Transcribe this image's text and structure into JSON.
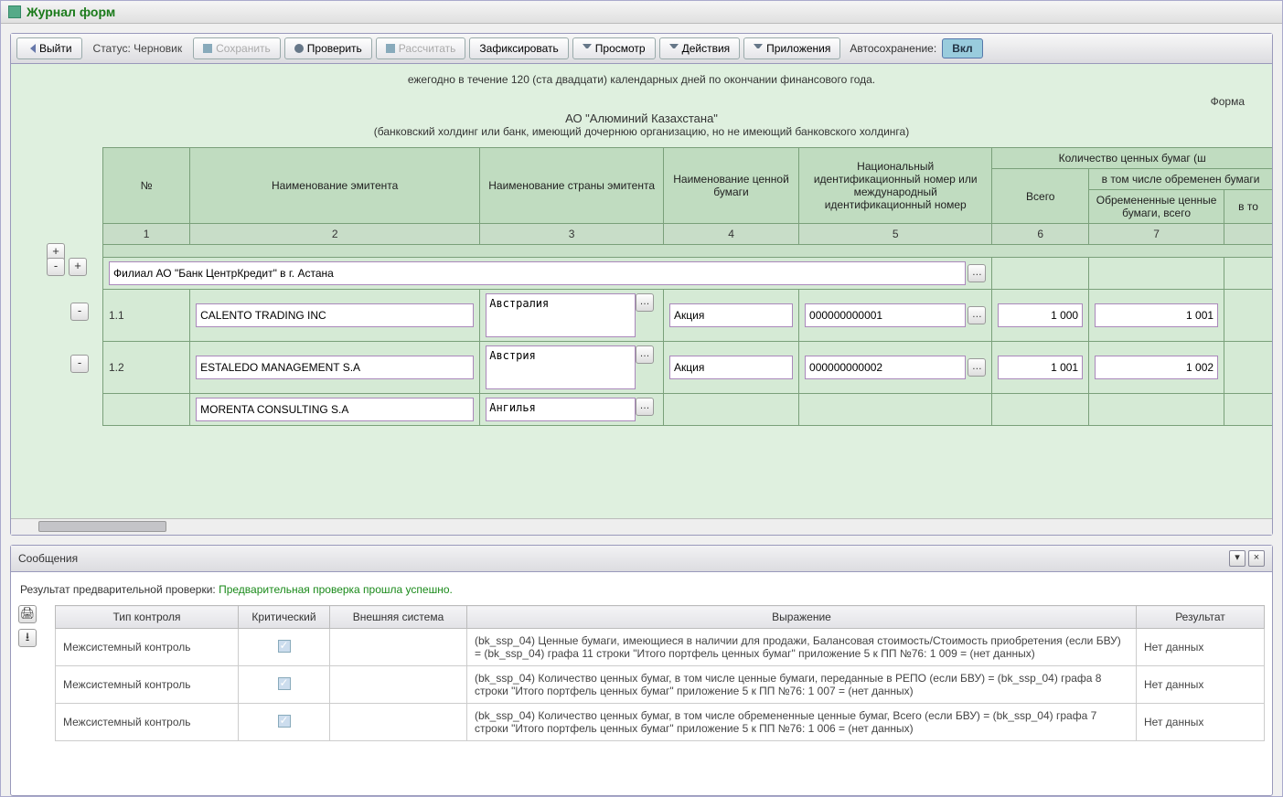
{
  "title": "Журнал форм",
  "toolbar": {
    "exit": "Выйти",
    "status_label": "Статус:",
    "status_value": "Черновик",
    "save": "Сохранить",
    "check": "Проверить",
    "calc": "Рассчитать",
    "fix": "Зафиксировать",
    "preview": "Просмотр",
    "actions": "Действия",
    "attachments": "Приложения",
    "autosave_label": "Автосохранение:",
    "autosave_on": "Вкл"
  },
  "form": {
    "desc": "ежегодно в течение 120 (ста двадцати) календарных дней по окончании финансового года.",
    "forma": "Форма",
    "org": "АО \"Алюминий Казахстана\"",
    "org_sub": "(банковский холдинг или банк, имеющий дочернюю организацию, но не имеющий банковского холдинга)"
  },
  "grid": {
    "headers": {
      "no": "№",
      "issuer": "Наименование эмитента",
      "country": "Наименование страны эмитента",
      "security": "Наименование ценной бумаги",
      "natid": "Национальный идентификационный номер или международный идентификационный номер",
      "qty_group": "Количество ценных бумаг (ш",
      "incl_group": "в том числе обременен бумаги",
      "total": "Всего",
      "encumbered": "Обремененные ценные бумаги, всего",
      "incl2": "в то"
    },
    "colnums": [
      "1",
      "2",
      "3",
      "4",
      "5",
      "6",
      "7"
    ],
    "branch": "Филиал АО \"Банк ЦентрКредит\" в г. Астана",
    "rows": [
      {
        "no": "1.1",
        "issuer": "CALENTO TRADING INC",
        "country": "Австралия",
        "security": "Акция",
        "natid": "000000000001",
        "total": "1 000",
        "enc": "1 001"
      },
      {
        "no": "1.2",
        "issuer": "ESTALEDO MANAGEMENT S.A",
        "country": "Австрия",
        "security": "Акция",
        "natid": "000000000002",
        "total": "1 001",
        "enc": "1 002"
      },
      {
        "no": "",
        "issuer": "MORENTA CONSULTING S.A",
        "country": "Ангилья",
        "security": "",
        "natid": "",
        "total": "",
        "enc": ""
      }
    ]
  },
  "messages": {
    "title": "Сообщения",
    "result_prefix": "Результат предварительной проверки: ",
    "result_ok": "Предварительная проверка прошла успешно.",
    "cols": {
      "type": "Тип контроля",
      "critical": "Критический",
      "ext": "Внешняя система",
      "expr": "Выражение",
      "res": "Результат"
    },
    "rows": [
      {
        "type": "Межсистемный контроль",
        "expr": "(bk_ssp_04) Ценные бумаги, имеющиеся в наличии для продажи, Балансовая стоимость/Стоимость приобретения (если БВУ) = (bk_ssp_04) графа 11 строки \"Итого портфель ценных бумаг\" приложение 5 к ПП №76: 1 009 = (нет данных)",
        "res": "Нет данных"
      },
      {
        "type": "Межсистемный контроль",
        "expr": "(bk_ssp_04) Количество ценных бумаг, в том числе ценные бумаги, переданные в РЕПО (если БВУ) = (bk_ssp_04) графа 8 строки \"Итого портфель ценных бумаг\" приложение 5 к ПП №76: 1 007 = (нет данных)",
        "res": "Нет данных"
      },
      {
        "type": "Межсистемный контроль",
        "expr": "(bk_ssp_04) Количество ценных бумаг, в том числе обремененные ценные бумаг, Всего (если БВУ) = (bk_ssp_04) графа 7 строки \"Итого портфель ценных бумаг\" приложение 5 к ПП №76: 1 006 = (нет данных)",
        "res": "Нет данных"
      }
    ]
  }
}
